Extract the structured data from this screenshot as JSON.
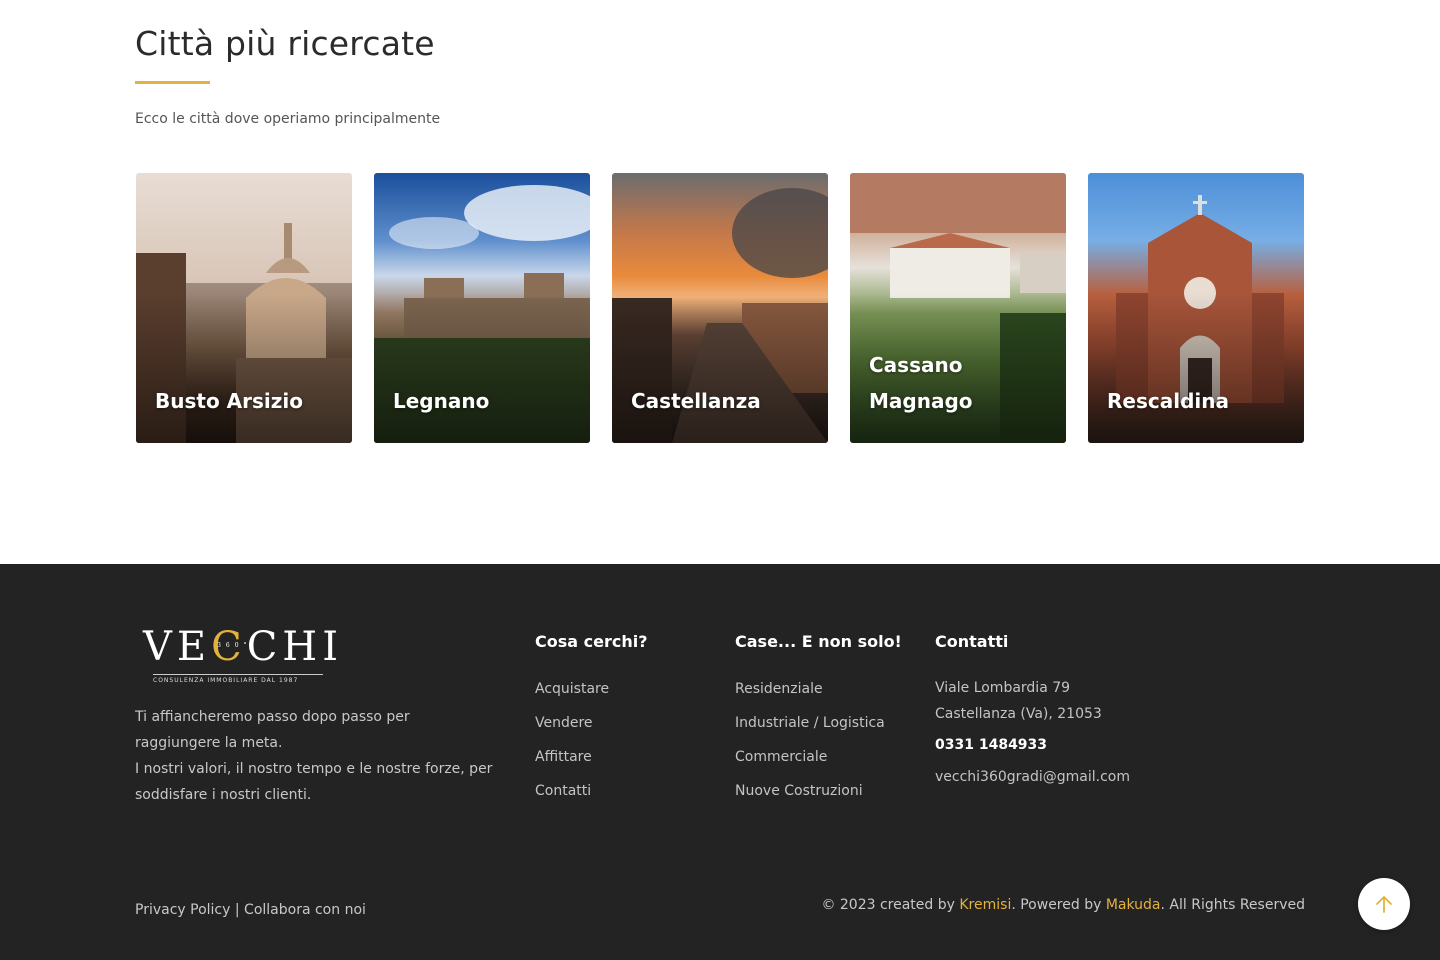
{
  "section": {
    "title": "Città più ricercate",
    "subtitle": "Ecco le città dove operiamo principalmente"
  },
  "cities": [
    {
      "name": "Busto Arsizio"
    },
    {
      "name": "Legnano"
    },
    {
      "name": "Castellanza"
    },
    {
      "name": "Cassano Magnago"
    },
    {
      "name": "Rescaldina"
    }
  ],
  "footer": {
    "logo": {
      "text": "VECCHI",
      "badge": "360°",
      "tagline": "CONSULENZA IMMOBILIARE DAL 1987"
    },
    "about_line1": "Ti affiancheremo passo dopo passo per raggiungere la meta.",
    "about_line2": "I nostri valori, il nostro tempo e le nostre forze, per soddisfare i nostri clienti.",
    "col1": {
      "title": "Cosa cerchi?",
      "links": [
        "Acquistare",
        "Vendere",
        "Affittare",
        "Contatti"
      ]
    },
    "col2": {
      "title": "Case... E non solo!",
      "links": [
        "Residenziale",
        "Industriale / Logistica",
        "Commerciale",
        "Nuove Costruzioni"
      ]
    },
    "contacts": {
      "title": "Contatti",
      "address1": "Viale Lombardia 79",
      "address2": "Castellanza (Va), 21053",
      "phone": "0331 1484933",
      "email": "vecchi360gradi@gmail.com"
    },
    "legal": {
      "privacy": "Privacy Policy",
      "separator": " | ",
      "collabora": "Collabora con noi"
    },
    "credits": {
      "prefix": "© 2023 created by ",
      "kremisi": "Kremisi",
      "middle": ". Powered by ",
      "makuda": "Makuda",
      "suffix": ". All Rights Reserved"
    }
  },
  "colors": {
    "accent": "#e3b23c",
    "footer_bg": "#232323"
  },
  "icons": {
    "to_top": "arrow-up-icon"
  }
}
